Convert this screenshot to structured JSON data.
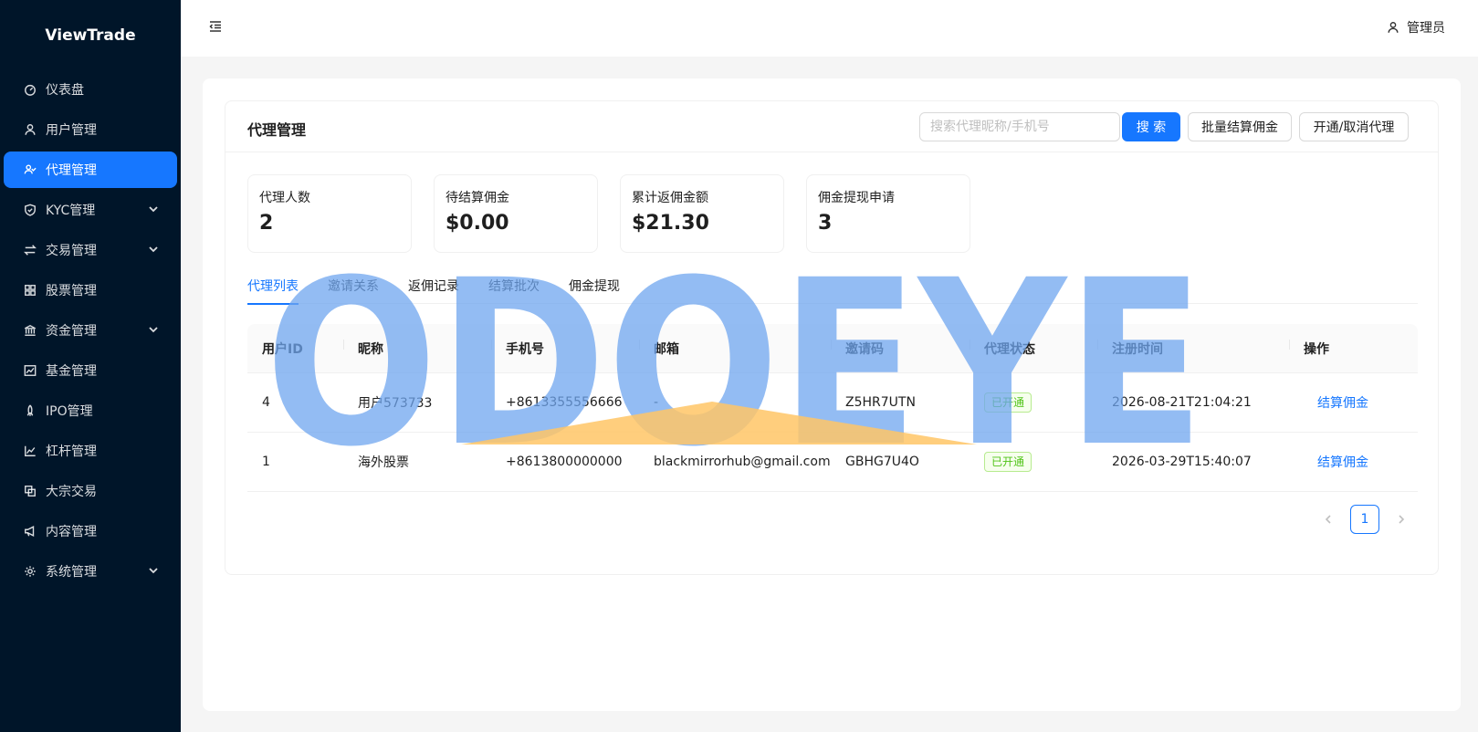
{
  "sidebar": {
    "logo": "ViewTrade",
    "items": [
      {
        "label": "仪表盘",
        "icon": "dashboard-icon"
      },
      {
        "label": "用户管理",
        "icon": "user-icon"
      },
      {
        "label": "代理管理",
        "icon": "agent-icon",
        "active": true
      },
      {
        "label": "KYC管理",
        "icon": "shield-icon",
        "expandable": true
      },
      {
        "label": "交易管理",
        "icon": "swap-icon",
        "expandable": true
      },
      {
        "label": "股票管理",
        "icon": "grid-icon"
      },
      {
        "label": "资金管理",
        "icon": "bank-icon",
        "expandable": true
      },
      {
        "label": "基金管理",
        "icon": "stock-chart-icon"
      },
      {
        "label": "IPO管理",
        "icon": "rocket-icon"
      },
      {
        "label": "杠杆管理",
        "icon": "line-chart-icon"
      },
      {
        "label": "大宗交易",
        "icon": "block-icon"
      },
      {
        "label": "内容管理",
        "icon": "notification-icon"
      },
      {
        "label": "系统管理",
        "icon": "setting-icon",
        "expandable": true
      }
    ]
  },
  "header": {
    "user_label": "管理员"
  },
  "page": {
    "title": "代理管理",
    "search_placeholder": "搜索代理昵称/手机号",
    "search_button": "搜 索",
    "batch_button": "批量结算佣金",
    "toggle_button": "开通/取消代理"
  },
  "stats": [
    {
      "label": "代理人数",
      "value": "2"
    },
    {
      "label": "待结算佣金",
      "value": "$0.00"
    },
    {
      "label": "累计返佣金额",
      "value": "$21.30"
    },
    {
      "label": "佣金提现申请",
      "value": "3"
    }
  ],
  "tabs": [
    {
      "label": "代理列表",
      "active": true
    },
    {
      "label": "邀请关系"
    },
    {
      "label": "返佣记录"
    },
    {
      "label": "结算批次"
    },
    {
      "label": "佣金提现"
    }
  ],
  "table": {
    "columns": [
      "用户ID",
      "昵称",
      "手机号",
      "邮箱",
      "邀请码",
      "代理状态",
      "注册时间",
      "操作"
    ],
    "rows": [
      {
        "id": "4",
        "nickname": "用户573733",
        "phone": "+8613355556666",
        "email": "-",
        "invite_code": "Z5HR7UTN",
        "status": "已开通",
        "registered": "2026-08-21T21:04:21",
        "action": "结算佣金"
      },
      {
        "id": "1",
        "nickname": "海外股票",
        "phone": "+8613800000000",
        "email": "blackmirrorhub@gmail.com",
        "invite_code": "GBHG7U4O",
        "status": "已开通",
        "registered": "2026-03-29T15:40:07",
        "action": "结算佣金"
      }
    ]
  },
  "pagination": {
    "current": "1"
  },
  "watermark": {
    "text": "ODOEYE",
    "color": "#6fa6ef",
    "accent_color": "#ffc566"
  },
  "colors": {
    "sidebar_bg": "#001529",
    "primary": "#1677ff",
    "success": "#52c41a"
  }
}
